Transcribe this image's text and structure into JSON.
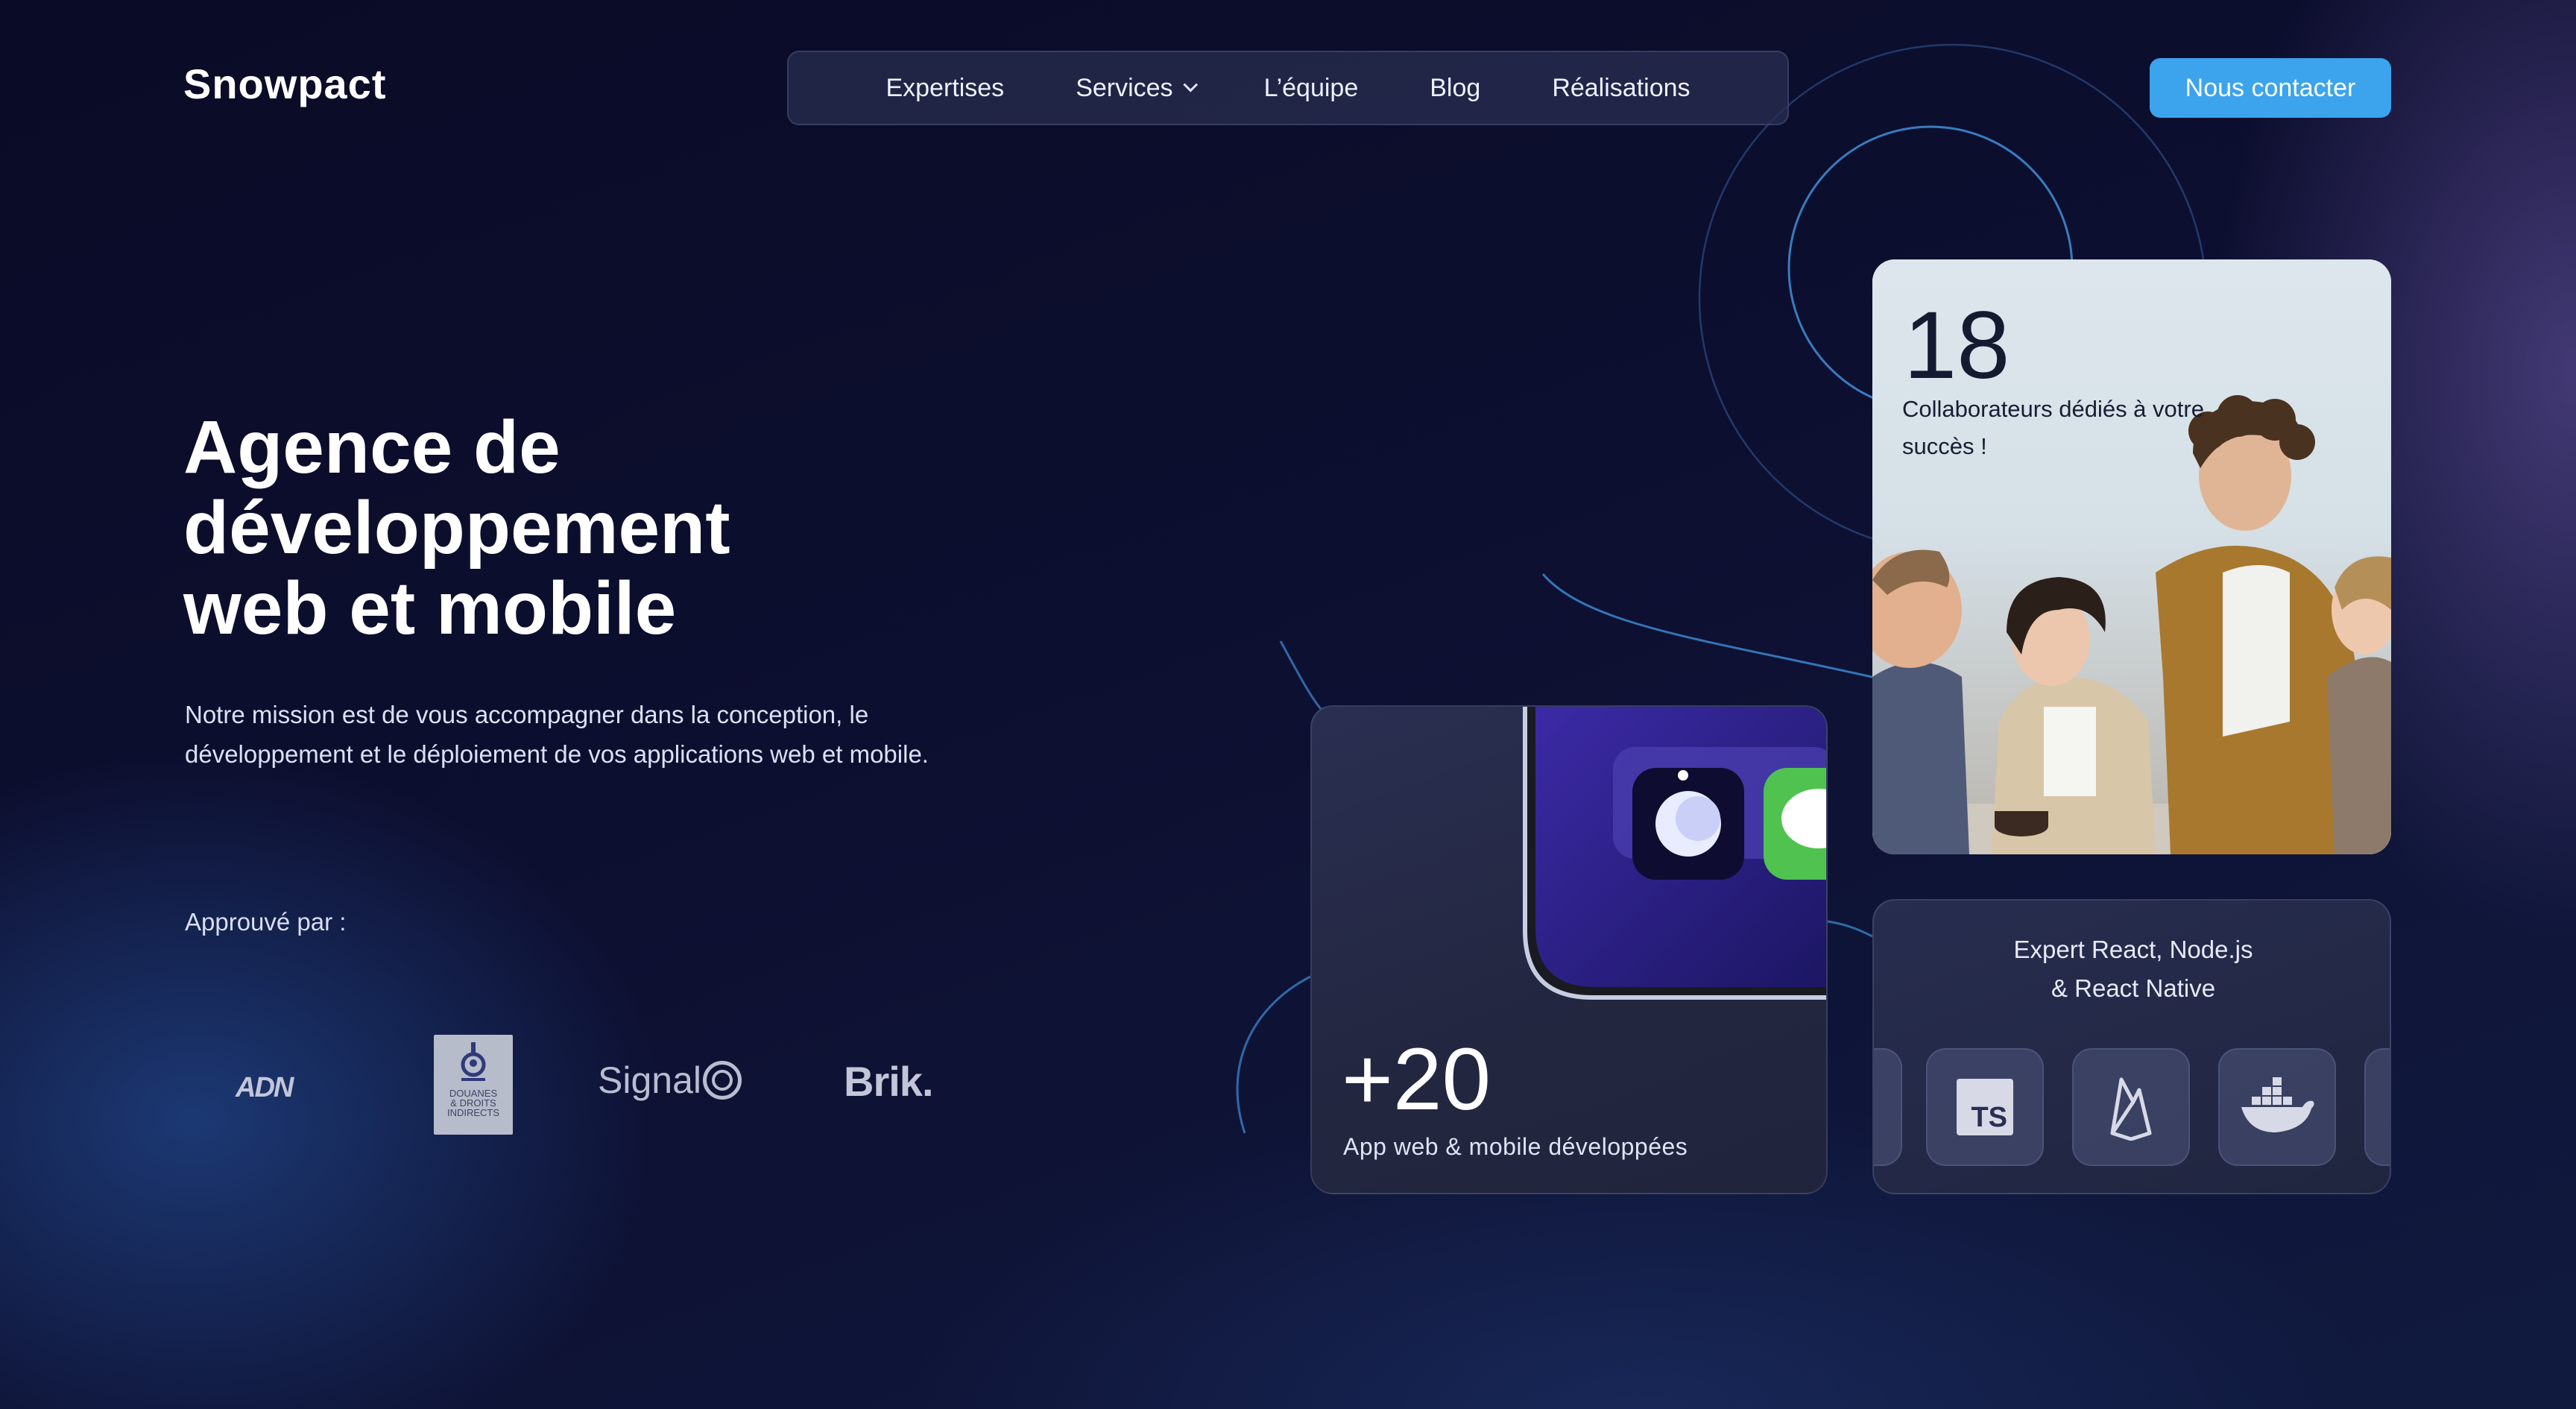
{
  "header": {
    "logo": "Snowpact",
    "nav": [
      "Expertises",
      "Services",
      "L’équipe",
      "Blog",
      "Réalisations"
    ],
    "cta": "Nous contacter"
  },
  "hero": {
    "title_lines": [
      "Agence de",
      "développement",
      "web et mobile"
    ],
    "description_lines": [
      "Notre mission est de vous accompagner dans la conception, le",
      "développement et le déploiement de vos applications web et mobile."
    ],
    "approved_label": "Approuvé par :",
    "partners": {
      "adn": "ADN",
      "douanes": [
        "DOUANES",
        "& DROITS",
        "INDIRECTS"
      ],
      "signal": "Signal",
      "brik": "Brik."
    }
  },
  "cards": {
    "team": {
      "number": "18",
      "caption_lines": [
        "Collaborateurs dédiés à votre",
        "succès !"
      ]
    },
    "apps": {
      "number": "+20",
      "caption": "App web & mobile développées"
    },
    "tech": {
      "title_lines": [
        "Expert React, Node.js",
        "& React Native"
      ],
      "icons": [
        "typescript-icon",
        "firebase-icon",
        "docker-icon"
      ]
    }
  },
  "colors": {
    "accent": "#3ba4ec",
    "background": "#0b0c2a",
    "card": "#22263f"
  }
}
